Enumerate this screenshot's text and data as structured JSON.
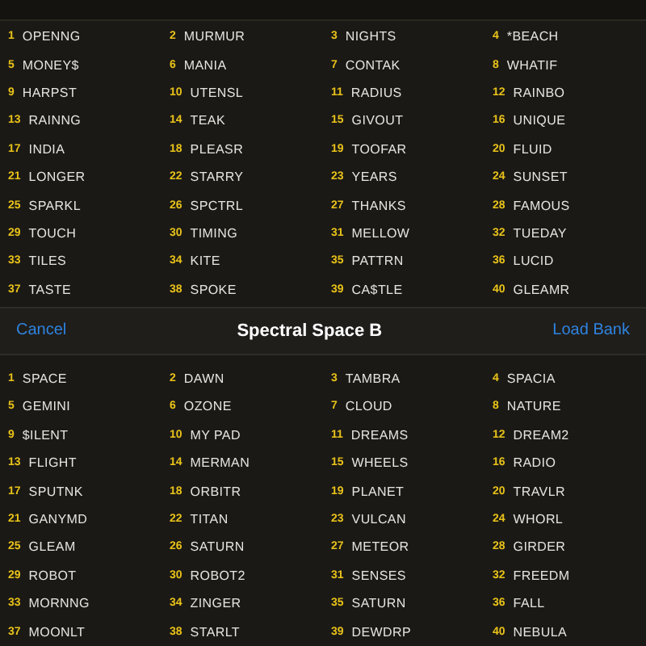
{
  "upper_list": {
    "presets": [
      {
        "number": "1",
        "name": "OPENNG"
      },
      {
        "number": "2",
        "name": "MURMUR"
      },
      {
        "number": "3",
        "name": "NIGHTS"
      },
      {
        "number": "4",
        "name": "*BEACH"
      },
      {
        "number": "5",
        "name": "MONEY$"
      },
      {
        "number": "6",
        "name": "MANIA"
      },
      {
        "number": "7",
        "name": "CONTAK"
      },
      {
        "number": "8",
        "name": "WHATIF"
      },
      {
        "number": "9",
        "name": "HARPST"
      },
      {
        "number": "10",
        "name": "UTENSL"
      },
      {
        "number": "11",
        "name": "RADIUS"
      },
      {
        "number": "12",
        "name": "RAINBO"
      },
      {
        "number": "13",
        "name": "RAINNG"
      },
      {
        "number": "14",
        "name": "TEAK"
      },
      {
        "number": "15",
        "name": "GIVOUT"
      },
      {
        "number": "16",
        "name": "UNIQUE"
      },
      {
        "number": "17",
        "name": "INDIA"
      },
      {
        "number": "18",
        "name": "PLEASR"
      },
      {
        "number": "19",
        "name": "TOOFAR"
      },
      {
        "number": "20",
        "name": "FLUID"
      },
      {
        "number": "21",
        "name": "LONGER"
      },
      {
        "number": "22",
        "name": "STARRY"
      },
      {
        "number": "23",
        "name": "YEARS"
      },
      {
        "number": "24",
        "name": "SUNSET"
      },
      {
        "number": "25",
        "name": "SPARKL"
      },
      {
        "number": "26",
        "name": "SPCTRL"
      },
      {
        "number": "27",
        "name": "THANKS"
      },
      {
        "number": "28",
        "name": "FAMOUS"
      },
      {
        "number": "29",
        "name": "TOUCH"
      },
      {
        "number": "30",
        "name": "TIMING"
      },
      {
        "number": "31",
        "name": "MELLOW"
      },
      {
        "number": "32",
        "name": "TUEDAY"
      },
      {
        "number": "33",
        "name": "TILES"
      },
      {
        "number": "34",
        "name": "KITE"
      },
      {
        "number": "35",
        "name": "PATTRN"
      },
      {
        "number": "36",
        "name": "LUCID"
      },
      {
        "number": "37",
        "name": "TASTE"
      },
      {
        "number": "38",
        "name": "SPOKE"
      },
      {
        "number": "39",
        "name": "CA$TLE"
      },
      {
        "number": "40",
        "name": "GLEAMR"
      }
    ]
  },
  "toolbar": {
    "cancel": "Cancel",
    "title": "Spectral Space B",
    "load": "Load Bank"
  },
  "lower_list": {
    "presets": [
      {
        "number": "1",
        "name": "SPACE"
      },
      {
        "number": "2",
        "name": "DAWN"
      },
      {
        "number": "3",
        "name": "TAMBRA"
      },
      {
        "number": "4",
        "name": "SPACIA"
      },
      {
        "number": "5",
        "name": "GEMINI"
      },
      {
        "number": "6",
        "name": "OZONE"
      },
      {
        "number": "7",
        "name": "CLOUD"
      },
      {
        "number": "8",
        "name": "NATURE"
      },
      {
        "number": "9",
        "name": "$ILENT"
      },
      {
        "number": "10",
        "name": "MY PAD"
      },
      {
        "number": "11",
        "name": "DREAMS"
      },
      {
        "number": "12",
        "name": "DREAM2"
      },
      {
        "number": "13",
        "name": "FLIGHT"
      },
      {
        "number": "14",
        "name": "MERMAN"
      },
      {
        "number": "15",
        "name": "WHEELS"
      },
      {
        "number": "16",
        "name": "RADIO"
      },
      {
        "number": "17",
        "name": "SPUTNK"
      },
      {
        "number": "18",
        "name": "ORBITR"
      },
      {
        "number": "19",
        "name": "PLANET"
      },
      {
        "number": "20",
        "name": "TRAVLR"
      },
      {
        "number": "21",
        "name": "GANYMD"
      },
      {
        "number": "22",
        "name": "TITAN"
      },
      {
        "number": "23",
        "name": "VULCAN"
      },
      {
        "number": "24",
        "name": "WHORL"
      },
      {
        "number": "25",
        "name": "GLEAM"
      },
      {
        "number": "26",
        "name": "SATURN"
      },
      {
        "number": "27",
        "name": "METEOR"
      },
      {
        "number": "28",
        "name": "GIRDER"
      },
      {
        "number": "29",
        "name": "ROBOT"
      },
      {
        "number": "30",
        "name": "ROBOT2"
      },
      {
        "number": "31",
        "name": "SENSES"
      },
      {
        "number": "32",
        "name": "FREEDM"
      },
      {
        "number": "33",
        "name": "MORNNG"
      },
      {
        "number": "34",
        "name": "ZINGER"
      },
      {
        "number": "35",
        "name": "SATURN"
      },
      {
        "number": "36",
        "name": "FALL"
      },
      {
        "number": "37",
        "name": "MOONLT"
      },
      {
        "number": "38",
        "name": "STARLT"
      },
      {
        "number": "39",
        "name": "DEWDRP"
      },
      {
        "number": "40",
        "name": "NEBULA"
      }
    ]
  }
}
